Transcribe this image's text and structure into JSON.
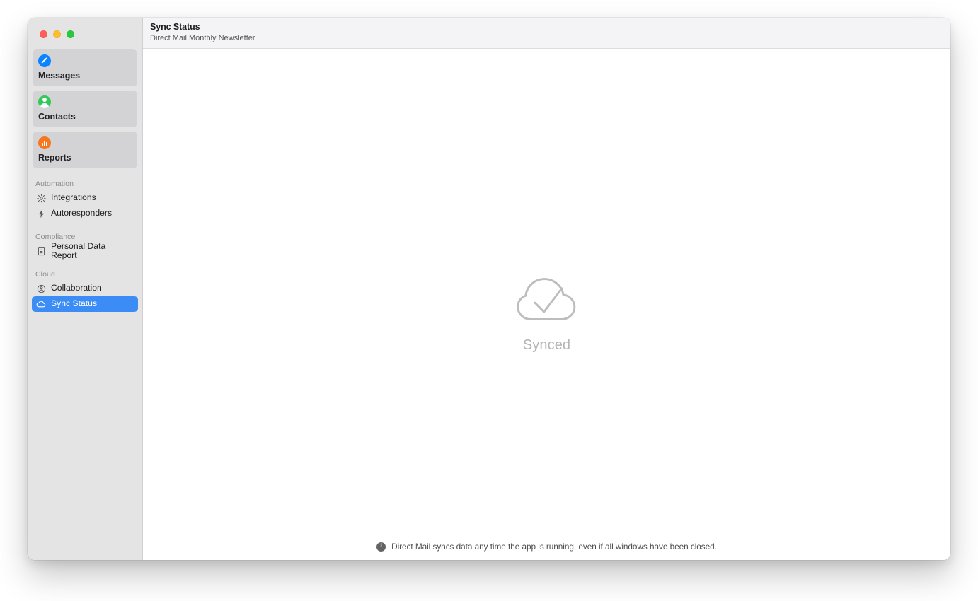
{
  "window": {
    "traffic_lights": [
      {
        "name": "close",
        "color": "#ff5f57"
      },
      {
        "name": "minimize",
        "color": "#febc2e"
      },
      {
        "name": "zoom",
        "color": "#28c840"
      }
    ]
  },
  "sidebar": {
    "cards": [
      {
        "label": "Messages",
        "icon": "compose-pencil-icon",
        "color": "#0a84ff"
      },
      {
        "label": "Contacts",
        "icon": "person-icon",
        "color": "#34c759"
      },
      {
        "label": "Reports",
        "icon": "bar-chart-icon",
        "color": "#f5781f"
      }
    ],
    "groups": [
      {
        "title": "Automation",
        "items": [
          {
            "label": "Integrations",
            "icon": "gear-icon",
            "selected": false
          },
          {
            "label": "Autoresponders",
            "icon": "bolt-icon",
            "selected": false
          }
        ]
      },
      {
        "title": "Compliance",
        "items": [
          {
            "label": "Personal Data Report",
            "icon": "document-icon",
            "selected": false
          }
        ]
      },
      {
        "title": "Cloud",
        "items": [
          {
            "label": "Collaboration",
            "icon": "person-circle-icon",
            "selected": false
          },
          {
            "label": "Sync Status",
            "icon": "cloud-icon",
            "selected": true
          }
        ]
      }
    ],
    "selection_color": "#3b8cf5"
  },
  "header": {
    "title": "Sync Status",
    "subtitle": "Direct Mail Monthly Newsletter"
  },
  "main": {
    "status_icon": "cloud-check-icon",
    "status_label": "Synced",
    "status_color": "#b4b4b6"
  },
  "footer": {
    "icon": "info-icon",
    "icon_glyph": "i",
    "text": "Direct Mail syncs data any time the app is running, even if all windows have been closed."
  }
}
